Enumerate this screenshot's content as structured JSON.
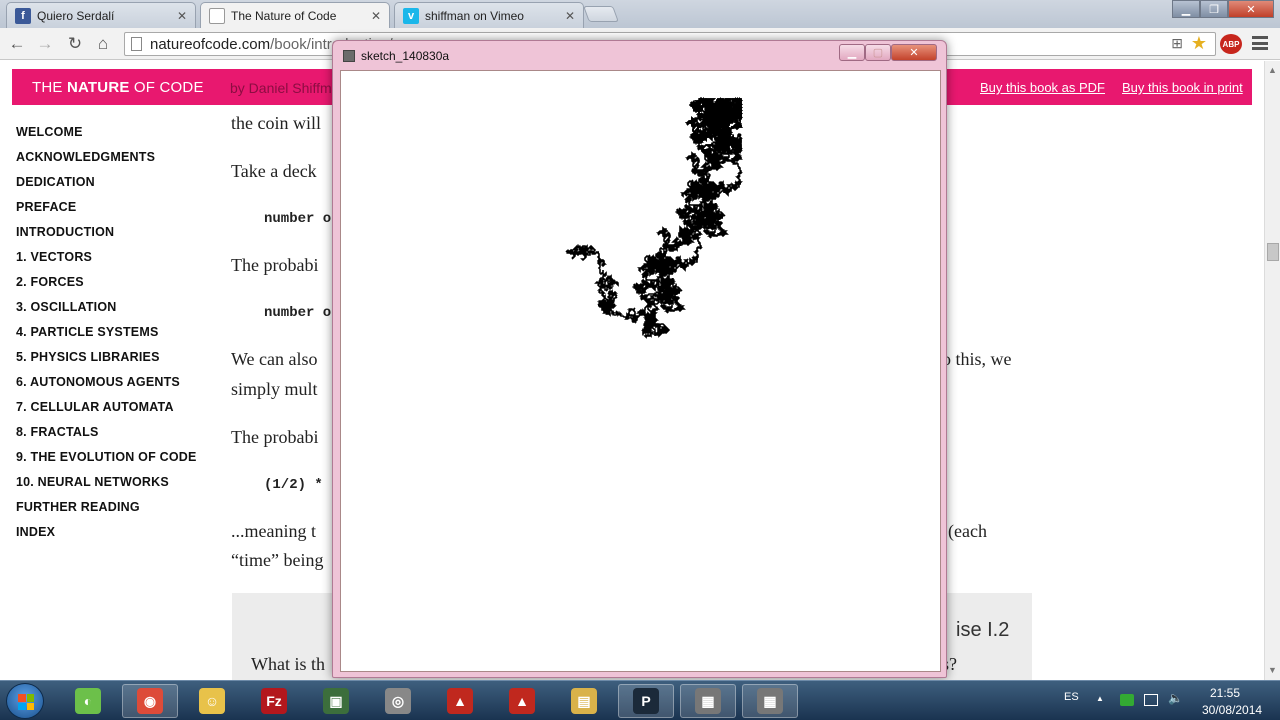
{
  "browser": {
    "tabs": [
      {
        "title": "Quiero Serdalí",
        "favicon": "facebook-icon",
        "active": false
      },
      {
        "title": "The Nature of Code",
        "favicon": "page-icon",
        "active": true
      },
      {
        "title": "shiffman on Vimeo",
        "favicon": "vimeo-icon",
        "active": false
      }
    ],
    "url_host": "natureofcode.com",
    "url_path": "/book/introduction/",
    "extension_label": "ABP"
  },
  "site": {
    "logo_prefix": "THE ",
    "logo_bold": "NATURE",
    "logo_suffix": " OF CODE",
    "byline": "by Daniel Shiffman",
    "buy_pdf": "Buy this book as PDF",
    "buy_print": "Buy this book in print",
    "accent_color": "#e8186f"
  },
  "toc": [
    "WELCOME",
    "ACKNOWLEDGMENTS",
    "DEDICATION",
    "PREFACE",
    "INTRODUCTION",
    "1. VECTORS",
    "2. FORCES",
    "3. OSCILLATION",
    "4. PARTICLE SYSTEMS",
    "5. PHYSICS LIBRARIES",
    "6. AUTONOMOUS AGENTS",
    "7. CELLULAR AUTOMATA",
    "8. FRACTALS",
    "9. THE EVOLUTION OF CODE",
    "10. NEURAL NETWORKS",
    "FURTHER READING",
    "INDEX"
  ],
  "article": {
    "line1": "the coin will",
    "line2": "Take a deck",
    "code1": "number o",
    "line3": "The probabi",
    "code2": "number o",
    "line4a": "We can also",
    "line4b": "o this, we",
    "line5": "simply mult",
    "line6": "The probabi",
    "code3": "(1/2) *",
    "line7a": "...meaning t",
    "line7b": "(each",
    "line8": "“time” being",
    "exercise_label": "ise I.2",
    "exercise_text_a": "What is th",
    "exercise_text_b": "s?"
  },
  "sketch_window": {
    "title": "sketch_140830a",
    "seed": 140830,
    "walk_steps": 60000,
    "ink_color": "#000000"
  },
  "taskbar": {
    "apps": [
      {
        "name": "android-app-icon",
        "open": false
      },
      {
        "name": "chrome-icon",
        "open": true
      },
      {
        "name": "file-manager-icon",
        "open": false
      },
      {
        "name": "filezilla-icon",
        "open": false
      },
      {
        "name": "terminal-icon",
        "open": false
      },
      {
        "name": "media-icon",
        "open": false
      },
      {
        "name": "autocad-icon",
        "open": false
      },
      {
        "name": "autocad-alt-icon",
        "open": false
      },
      {
        "name": "explorer-icon",
        "open": false
      },
      {
        "name": "processing-icon",
        "open": true
      },
      {
        "name": "sketch-window-icon",
        "open": true
      },
      {
        "name": "sketch-window-2-icon",
        "open": true
      }
    ],
    "language": "ES",
    "time": "21:55",
    "date": "30/08/2014"
  }
}
